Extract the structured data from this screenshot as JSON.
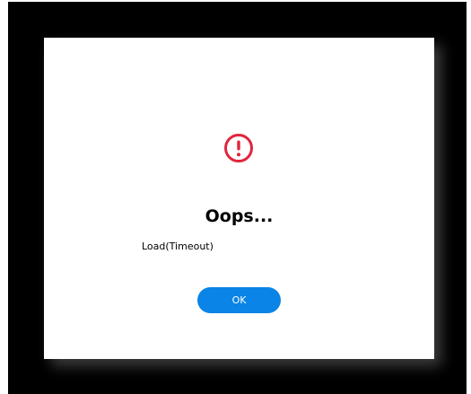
{
  "dialog": {
    "icon": "exclamation-circle-icon",
    "icon_color": "#e0253b",
    "title": "Oops...",
    "message": "Load(Timeout)",
    "ok_label": "OK",
    "button_color": "#0a84e6"
  }
}
